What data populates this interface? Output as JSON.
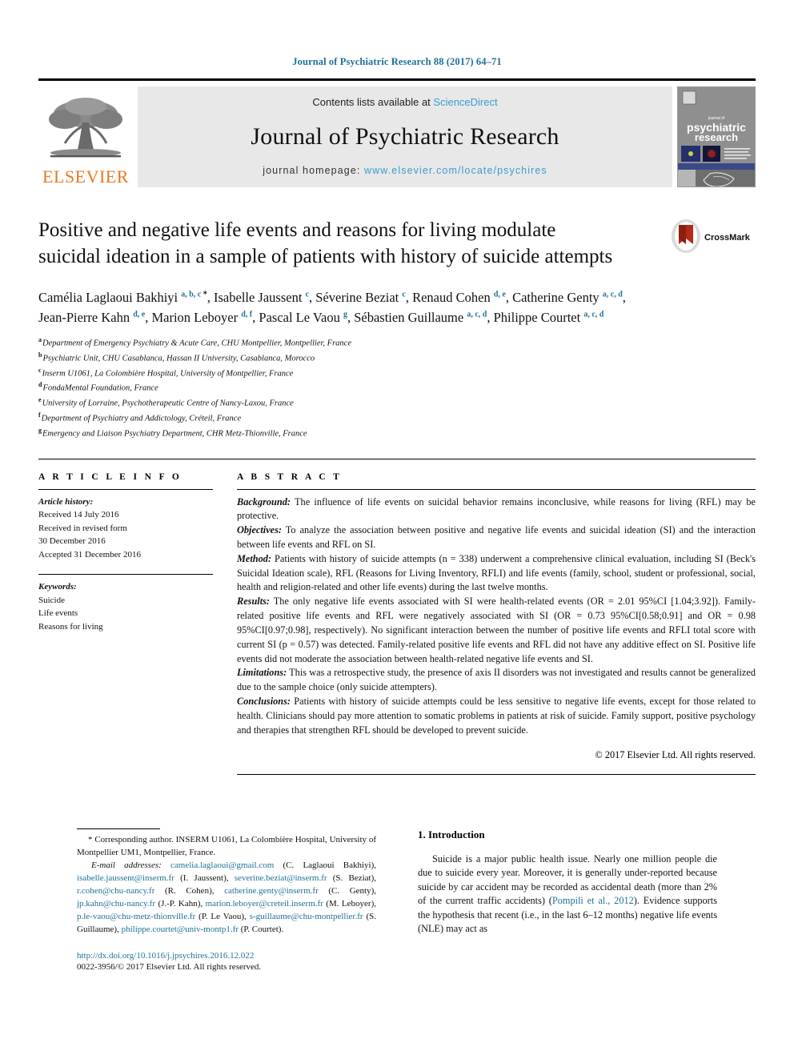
{
  "header": {
    "citation": "Journal of Psychiatric Research 88 (2017) 64–71",
    "contents_prefix": "Contents lists available at ",
    "contents_link": "ScienceDirect",
    "journal_name": "Journal of Psychiatric Research",
    "homepage_prefix": "journal homepage: ",
    "homepage_url": "www.elsevier.com/locate/psychires",
    "publisher_logo_text": "ELSEVIER",
    "cover_title_line1": "psychiatric",
    "cover_title_line2": "research",
    "cover_kicker": "journal of"
  },
  "title": {
    "text": "Positive and negative life events and reasons for living modulate suicidal ideation in a sample of patients with history of suicide attempts",
    "crossmark_label": "CrossMark"
  },
  "authors": [
    {
      "name": "Camélia Laglaoui Bakhiyi",
      "marks": "a, b, c",
      "star": true,
      "sep": ", "
    },
    {
      "name": "Isabelle Jaussent",
      "marks": "c",
      "star": false,
      "sep": ", "
    },
    {
      "name": "Séverine Beziat",
      "marks": "c",
      "star": false,
      "sep": ", "
    },
    {
      "name": "Renaud Cohen",
      "marks": "d, e",
      "star": false,
      "sep": ", "
    },
    {
      "name": "Catherine Genty",
      "marks": "a, c, d",
      "star": false,
      "sep": ", "
    },
    {
      "name": "Jean-Pierre Kahn",
      "marks": "d, e",
      "star": false,
      "sep": ", "
    },
    {
      "name": "Marion Leboyer",
      "marks": "d, f",
      "star": false,
      "sep": ", "
    },
    {
      "name": "Pascal Le Vaou",
      "marks": "g",
      "star": false,
      "sep": ", "
    },
    {
      "name": "Sébastien Guillaume",
      "marks": "a, c, d",
      "star": false,
      "sep": ", "
    },
    {
      "name": "Philippe Courtet",
      "marks": "a, c, d",
      "star": false,
      "sep": ""
    }
  ],
  "affiliations": [
    {
      "label": "a",
      "text": "Department of Emergency Psychiatry & Acute Care, CHU Montpellier, Montpellier, France"
    },
    {
      "label": "b",
      "text": "Psychiatric Unit, CHU Casablanca, Hassan II University, Casablanca, Morocco"
    },
    {
      "label": "c",
      "text": "Inserm U1061, La Colombière Hospital, University of Montpellier, France"
    },
    {
      "label": "d",
      "text": "FondaMental Foundation, France"
    },
    {
      "label": "e",
      "text": "University of Lorraine, Psychotherapeutic Centre of Nancy-Laxou, France"
    },
    {
      "label": "f",
      "text": "Department of Psychiatry and Addictology, Créteil, France"
    },
    {
      "label": "g",
      "text": "Emergency and Liaison Psychiatry Department, CHR Metz-Thionville, France"
    }
  ],
  "article_info": {
    "heading": "A R T I C L E   I N F O",
    "history_label": "Article history:",
    "history_lines": [
      "Received 14 July 2016",
      "Received in revised form",
      "30 December 2016",
      "Accepted 31 December 2016"
    ],
    "keywords_label": "Keywords:",
    "keywords": [
      "Suicide",
      "Life events",
      "Reasons for living"
    ]
  },
  "abstract": {
    "heading": "A B S T R A C T",
    "sections": [
      {
        "lead": "Background:",
        "text": " The influence of life events on suicidal behavior remains inconclusive, while reasons for living (RFL) may be protective."
      },
      {
        "lead": "Objectives:",
        "text": " To analyze the association between positive and negative life events and suicidal ideation (SI) and the interaction between life events and RFL on SI."
      },
      {
        "lead": "Method:",
        "text": " Patients with history of suicide attempts (n = 338) underwent a comprehensive clinical evaluation, including SI (Beck's Suicidal Ideation scale), RFL (Reasons for Living Inventory, RFLI) and life events (family, school, student or professional, social, health and religion-related and other life events) during the last twelve months."
      },
      {
        "lead": "Results:",
        "text": " The only negative life events associated with SI were health-related events (OR = 2.01 95%CI [1.04;3.92]). Family-related positive life events and RFL were negatively associated with SI (OR = 0.73 95%CI[0.58;0.91] and OR = 0.98 95%CI[0.97;0.98], respectively). No significant interaction between the number of positive life events and RFLI total score with current SI (p = 0.57) was detected. Family-related positive life events and RFL did not have any additive effect on SI. Positive life events did not moderate the association between health-related negative life events and SI."
      },
      {
        "lead": "Limitations:",
        "text": " This was a retrospective study, the presence of axis II disorders was not investigated and results cannot be generalized due to the sample choice (only suicide attempters)."
      },
      {
        "lead": "Conclusions:",
        "text": " Patients with history of suicide attempts could be less sensitive to negative life events, except for those related to health. Clinicians should pay more attention to somatic problems in patients at risk of suicide. Family support, positive psychology and therapies that strengthen RFL should be developed to prevent suicide."
      }
    ],
    "copyright": "© 2017 Elsevier Ltd. All rights reserved."
  },
  "footnote": {
    "corresponding": "* Corresponding author. INSERM U1061, La Colombière Hospital, University of Montpellier UM1, Montpellier, France.",
    "email_label": "E-mail addresses:",
    "emails": [
      {
        "addr": "camelia.laglaoui@gmail.com",
        "who": " (C. Laglaoui Bakhiyi), "
      },
      {
        "addr": "isabelle.jaussent@inserm.fr",
        "who": " (I. Jaussent), "
      },
      {
        "addr": "severine.beziat@inserm.fr",
        "who": " (S. Beziat), "
      },
      {
        "addr": "r.cohen@chu-nancy.fr",
        "who": " (R. Cohen), "
      },
      {
        "addr": "catherine.genty@inserm.fr",
        "who": " (C. Genty), "
      },
      {
        "addr": "jp.kahn@chu-nancy.fr",
        "who": " (J.-P. Kahn), "
      },
      {
        "addr": "marion.leboyer@creteil.inserm.fr",
        "who": " (M. Leboyer), "
      },
      {
        "addr": "p.le-vaou@chu-metz-thionville.fr",
        "who": " (P. Le Vaou), "
      },
      {
        "addr": "s-guillaume@chu-montpellier.fr",
        "who": " (S. Guillaume), "
      },
      {
        "addr": "philippe.courtet@univ-montp1.fr",
        "who": " (P. Courtet)."
      }
    ],
    "doi": "http://dx.doi.org/10.1016/j.jpsychires.2016.12.022",
    "issn": "0022-3956/© 2017 Elsevier Ltd. All rights reserved."
  },
  "introduction": {
    "heading": "1. Introduction",
    "paragraph_part1": "Suicide is a major public health issue. Nearly one million people die due to suicide every year. Moreover, it is generally under-reported because suicide by car accident may be recorded as accidental death (more than 2% of the current traffic accidents) (",
    "citation1": "Pompili et al., 2012",
    "paragraph_part2": "). Evidence supports the hypothesis that recent (i.e., in the last 6–12 months) negative life events (NLE) may act as"
  },
  "colors": {
    "link": "#3c9bd0",
    "citation_blue": "#1f7096",
    "elsevier_orange": "#e87722",
    "masthead_grey": "#e8e8e8"
  }
}
